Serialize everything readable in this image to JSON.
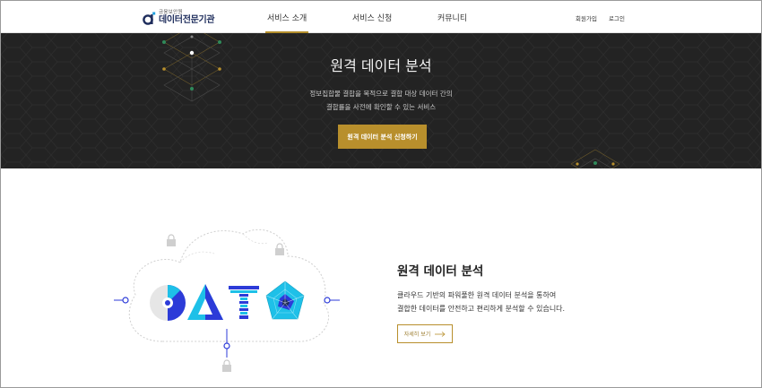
{
  "header": {
    "logo": {
      "sub": "금융보안원",
      "main": "데이터전문기관"
    },
    "nav": [
      {
        "label": "서비스 소개",
        "active": true
      },
      {
        "label": "서비스 신청",
        "active": false
      },
      {
        "label": "커뮤니티",
        "active": false
      }
    ],
    "util": {
      "signup": "회원가입",
      "login": "로그인"
    }
  },
  "hero": {
    "title": "원격 데이터 분석",
    "desc_line1": "정보집합물 결합을 목적으로 결합 대상 데이터 간의",
    "desc_line2": "결합률을 사전에 확인할 수 있는 서비스",
    "button": "원격 데이터 분석 신청하기"
  },
  "section": {
    "title": "원격 데이터 분석",
    "desc_line1": "클라우드 기반의 파워풀한 원격 데이터 분석을 통하여",
    "desc_line2": "결합한 데이터를 안전하고 편리하게 분석할 수 있습니다.",
    "more_button": "자세히 보기"
  },
  "colors": {
    "accent": "#b88f2c",
    "navy": "#1e2d5c",
    "hero_bg": "#232323",
    "blue": "#2c3bd8",
    "cyan": "#1ec0e8"
  }
}
